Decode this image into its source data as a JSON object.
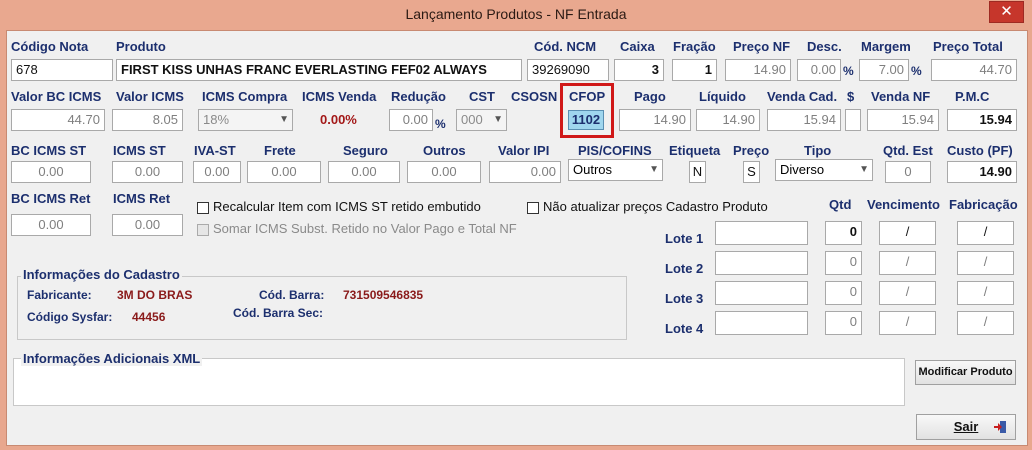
{
  "window": {
    "title": "Lançamento Produtos - NF Entrada",
    "close_glyph": "✕"
  },
  "row1": {
    "codigo_nota": {
      "label": "Código Nota",
      "value": "678"
    },
    "produto": {
      "label": "Produto",
      "value": "FIRST KISS UNHAS FRANC EVERLASTING FEF02 ALWAYS"
    },
    "cod_ncm": {
      "label": "Cód. NCM",
      "value": "39269090"
    },
    "caixa": {
      "label": "Caixa",
      "value": "3"
    },
    "fracao": {
      "label": "Fração",
      "value": "1"
    },
    "preco_nf": {
      "label": "Preço NF",
      "value": "14.90"
    },
    "desc": {
      "label": "Desc.",
      "value": "0.00",
      "suffix": "%"
    },
    "margem": {
      "label": "Margem",
      "value": "7.00",
      "suffix": "%"
    },
    "preco_total": {
      "label": "Preço Total",
      "value": "44.70"
    }
  },
  "row2": {
    "valor_bc_icms": {
      "label": "Valor BC ICMS",
      "value": "44.70"
    },
    "valor_icms": {
      "label": "Valor ICMS",
      "value": "8.05"
    },
    "icms_compra": {
      "label": "ICMS Compra",
      "value": "18%"
    },
    "icms_venda": {
      "label": "ICMS Venda",
      "value": "0.00%"
    },
    "reducao": {
      "label": "Redução",
      "value": "0.00",
      "suffix": "%"
    },
    "cst": {
      "label": "CST",
      "value": "000"
    },
    "csosn": {
      "label": "CSOSN"
    },
    "cfop": {
      "label": "CFOP",
      "value": "1102"
    },
    "pago": {
      "label": "Pago",
      "value": "14.90"
    },
    "liquido": {
      "label": "Líquido",
      "value": "14.90"
    },
    "venda_cad": {
      "label": "Venda Cad.",
      "value": "15.94"
    },
    "dollar": {
      "label": "$"
    },
    "venda_nf": {
      "label": "Venda NF",
      "value": "15.94"
    },
    "pmc": {
      "label": "P.M.C",
      "value": "15.94"
    }
  },
  "row3": {
    "bc_icms_st": {
      "label": "BC ICMS ST",
      "value": "0.00"
    },
    "icms_st": {
      "label": "ICMS ST",
      "value": "0.00"
    },
    "iva_st": {
      "label": "IVA-ST",
      "value": "0.00"
    },
    "frete": {
      "label": "Frete",
      "value": "0.00"
    },
    "seguro": {
      "label": "Seguro",
      "value": "0.00"
    },
    "outros": {
      "label": "Outros",
      "value": "0.00"
    },
    "valor_ipi": {
      "label": "Valor IPI",
      "value": "0.00"
    },
    "pis_cofins": {
      "label": "PIS/COFINS",
      "value": "Outros"
    },
    "etiqueta": {
      "label": "Etiqueta",
      "value": "N"
    },
    "preco": {
      "label": "Preço",
      "value": "S"
    },
    "tipo": {
      "label": "Tipo",
      "value": "Diverso"
    },
    "qtd_est": {
      "label": "Qtd. Est",
      "value": "0"
    },
    "custo_pf": {
      "label": "Custo (PF)",
      "value": "14.90"
    }
  },
  "row4": {
    "bc_icms_ret": {
      "label": "BC ICMS Ret",
      "value": "0.00"
    },
    "icms_ret": {
      "label": "ICMS Ret",
      "value": "0.00"
    },
    "chk_recalcular": "Recalcular Item com ICMS ST retido embutido",
    "chk_somar": "Somar ICMS Subst. Retido no Valor Pago e Total NF",
    "chk_nao_atualizar": "Não atualizar preços Cadastro Produto"
  },
  "lotes": {
    "headers": {
      "qtd": "Qtd",
      "vencimento": "Vencimento",
      "fabricacao": "Fabricação"
    },
    "rows": [
      {
        "label": "Lote 1",
        "lote": "",
        "qtd": "0",
        "vencimento": "/",
        "fabricacao": "/"
      },
      {
        "label": "Lote 2",
        "lote": "",
        "qtd": "0",
        "vencimento": "/",
        "fabricacao": "/"
      },
      {
        "label": "Lote 3",
        "lote": "",
        "qtd": "0",
        "vencimento": "/",
        "fabricacao": "/"
      },
      {
        "label": "Lote 4",
        "lote": "",
        "qtd": "0",
        "vencimento": "/",
        "fabricacao": "/"
      }
    ]
  },
  "cadastro": {
    "title": "Informações do Cadastro",
    "fabricante_label": "Fabricante:",
    "fabricante_value": "3M DO BRAS",
    "codigo_sysfar_label": "Código Sysfar:",
    "codigo_sysfar_value": "44456",
    "cod_barra_label": "Cód. Barra:",
    "cod_barra_value": "731509546835",
    "cod_barra_sec_label": "Cód. Barra Sec:",
    "cod_barra_sec_value": ""
  },
  "xml": {
    "title": "Informações Adicionais XML"
  },
  "buttons": {
    "modificar_produto": "Modificar Produto",
    "sair": "Sair"
  },
  "icons": {
    "close": "close-icon",
    "exit": "exit-door-icon",
    "dropdown": "chevron-down-icon"
  },
  "colors": {
    "label": "#1c2f6e",
    "title_bar": "#e9a88f",
    "highlight": "#d01818",
    "cfop_fill": "#9fd6ee"
  }
}
